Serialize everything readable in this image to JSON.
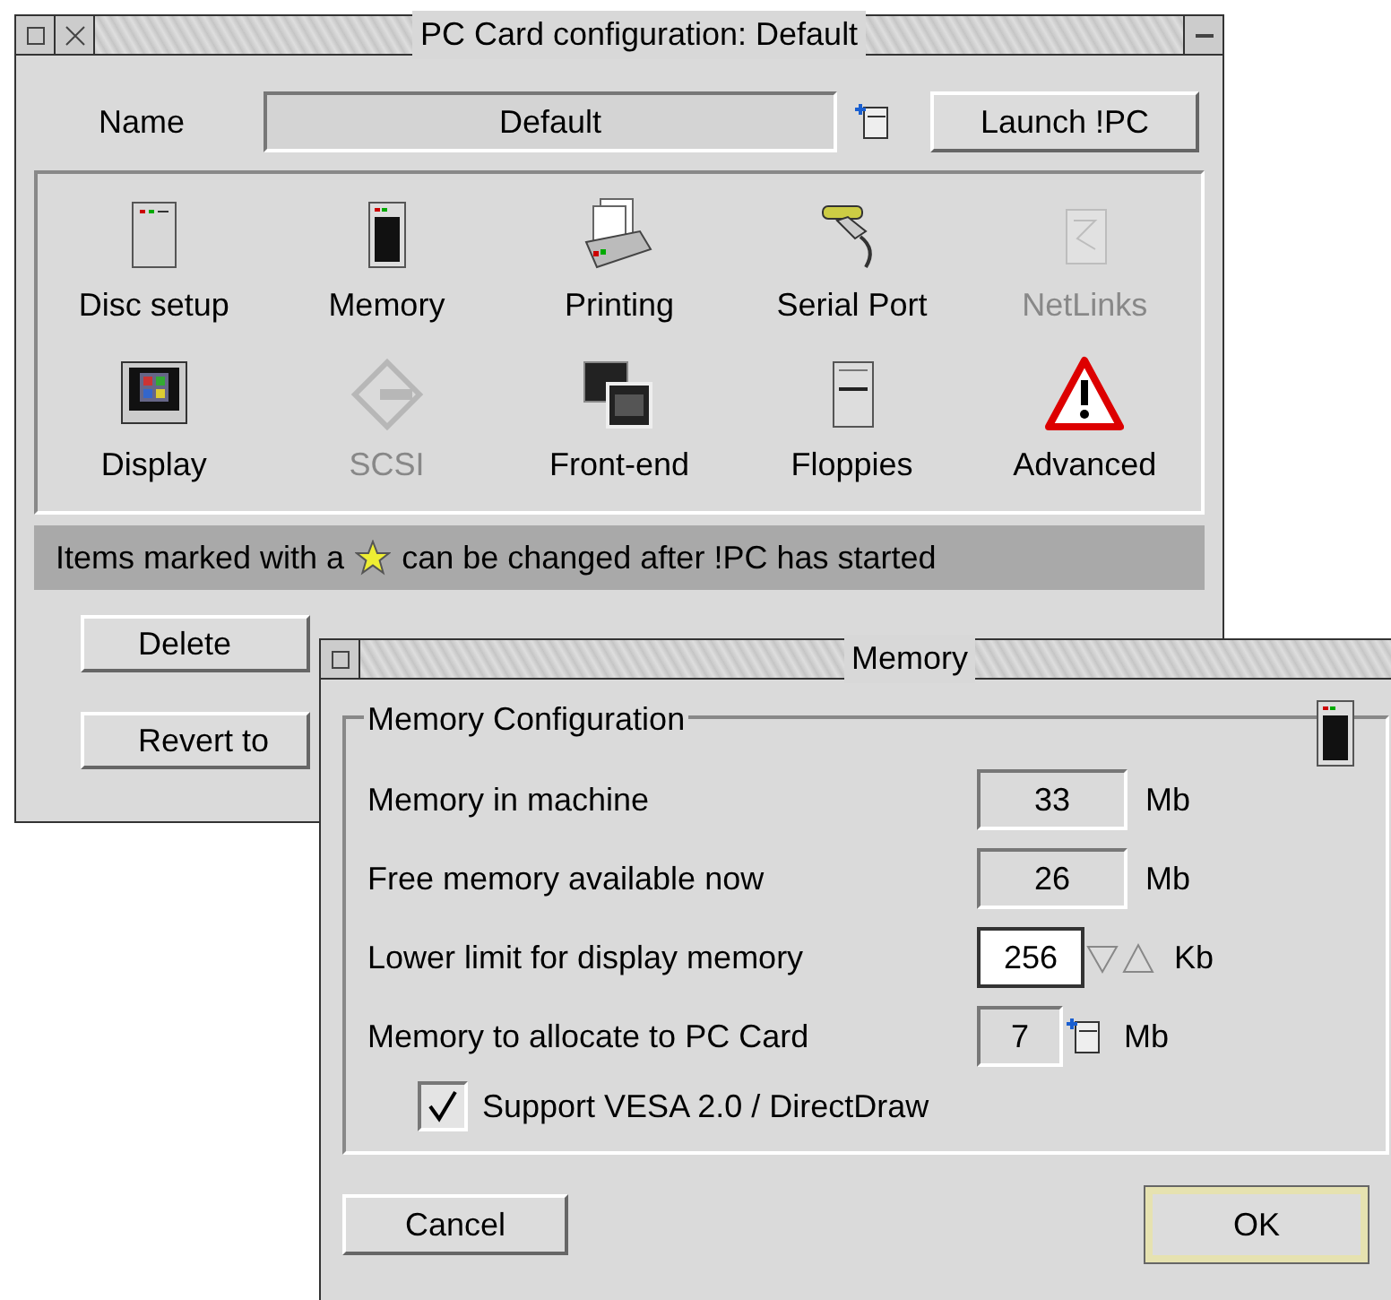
{
  "main_window": {
    "title": "PC Card configuration: Default",
    "name_label": "Name",
    "name_value": "Default",
    "launch_button": "Launch !PC",
    "items": [
      {
        "label": "Disc setup",
        "kind": "disc",
        "disabled": false
      },
      {
        "label": "Memory",
        "kind": "memory",
        "disabled": false
      },
      {
        "label": "Printing",
        "kind": "printer",
        "disabled": false
      },
      {
        "label": "Serial Port",
        "kind": "serial",
        "disabled": false
      },
      {
        "label": "NetLinks",
        "kind": "network",
        "disabled": true
      },
      {
        "label": "Display",
        "kind": "display",
        "disabled": false
      },
      {
        "label": "SCSI",
        "kind": "scsi",
        "disabled": true
      },
      {
        "label": "Front-end",
        "kind": "frontend",
        "disabled": false
      },
      {
        "label": "Floppies",
        "kind": "floppy",
        "disabled": false
      },
      {
        "label": "Advanced",
        "kind": "warning",
        "disabled": false
      }
    ],
    "status_before": "Items marked with a",
    "status_after": "can be changed after !PC has started",
    "buttons": [
      "Delete",
      "Revert to"
    ]
  },
  "memory_window": {
    "title": "Memory",
    "group_title": "Memory Configuration",
    "rows": [
      {
        "label": "Memory in machine",
        "kind": "display",
        "value": "33",
        "unit": "Mb"
      },
      {
        "label": "Free memory available now",
        "kind": "display",
        "value": "26",
        "unit": "Mb"
      },
      {
        "label": "Lower limit for display memory",
        "kind": "spinner",
        "value": "256",
        "unit": "Kb"
      },
      {
        "label": "Memory to allocate to PC Card",
        "kind": "menu",
        "value": "7",
        "unit": "Mb"
      }
    ],
    "checkbox": {
      "label": "Support VESA 2.0 / DirectDraw",
      "checked": true
    },
    "cancel_button": "Cancel",
    "ok_button": "OK"
  }
}
